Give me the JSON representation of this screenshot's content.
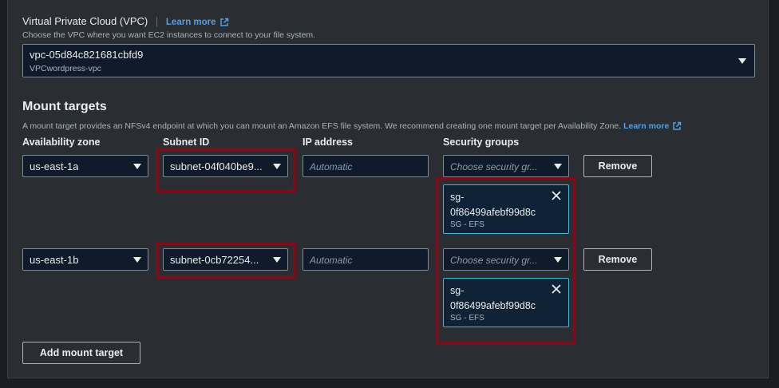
{
  "vpc": {
    "label": "Virtual Private Cloud (VPC)",
    "learn_more": "Learn more",
    "description": "Choose the VPC where you want EC2 instances to connect to your file system.",
    "selected_id": "vpc-05d84c821681cbfd9",
    "selected_name": "VPCwordpress-vpc"
  },
  "mount_targets": {
    "title": "Mount targets",
    "description": "A mount target provides an NFSv4 endpoint at which you can mount an Amazon EFS file system. We recommend creating one mount target per Availability Zone.",
    "learn_more": "Learn more",
    "columns": {
      "availability_zone": "Availability zone",
      "subnet_id": "Subnet ID",
      "ip_address": "IP address",
      "security_groups": "Security groups"
    },
    "rows": [
      {
        "az": "us-east-1a",
        "subnet": "subnet-04f040be9...",
        "ip_placeholder": "Automatic",
        "sg_placeholder": "Choose security gr...",
        "remove": "Remove",
        "sg_token_id": "sg-0f86499afebf99d8c",
        "sg_token_desc": "SG - EFS"
      },
      {
        "az": "us-east-1b",
        "subnet": "subnet-0cb72254...",
        "ip_placeholder": "Automatic",
        "sg_placeholder": "Choose security gr...",
        "remove": "Remove",
        "sg_token_id": "sg-0f86499afebf99d8c",
        "sg_token_desc": "SG - EFS"
      }
    ],
    "add_button": "Add mount target"
  },
  "colors": {
    "link": "#539fe5",
    "highlight": "#7a0f1c",
    "token_border": "#44b9d6"
  }
}
